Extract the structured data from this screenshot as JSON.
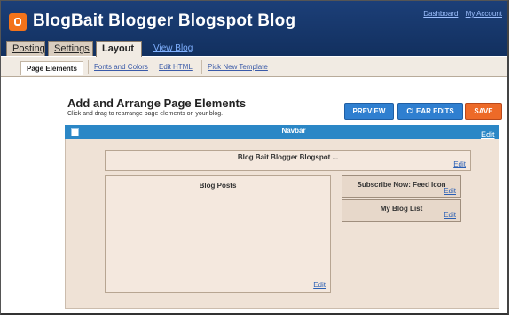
{
  "header": {
    "blog_title": "BlogBait Blogger Blogspot Blog",
    "links": [
      "Dashboard",
      "My Account"
    ]
  },
  "tabs": [
    {
      "label": "Posting"
    },
    {
      "label": "Settings"
    },
    {
      "label": "Layout"
    },
    {
      "label": "View Blog"
    }
  ],
  "subtabs": [
    {
      "label": "Page Elements"
    },
    {
      "label": "Fonts and Colors"
    },
    {
      "label": "Edit HTML"
    },
    {
      "label": "Pick New Template"
    }
  ],
  "main": {
    "title": "Add and Arrange Page Elements",
    "subtitle": "Click and drag to rearrange page elements on your blog.",
    "buttons": {
      "preview": "PREVIEW",
      "clear": "CLEAR EDITS",
      "save": "SAVE"
    }
  },
  "layout_editor": {
    "navbar": {
      "label": "Navbar",
      "edit": "Edit"
    },
    "header": {
      "label": "Blog Bait Blogger Blogspot ...",
      "edit": "Edit"
    },
    "blog_posts": {
      "label": "Blog Posts",
      "edit": "Edit"
    },
    "sidebar": [
      {
        "label": "Subscribe Now: Feed Icon",
        "edit": "Edit"
      },
      {
        "label": "My Blog List",
        "edit": "Edit"
      }
    ]
  },
  "colors": {
    "header_bg": "#1c3f78",
    "navbar_bg": "#2b87c6",
    "button_blue": "#2f7fd0",
    "button_orange": "#ed6a28",
    "canvas_bg": "#efe2d6"
  }
}
